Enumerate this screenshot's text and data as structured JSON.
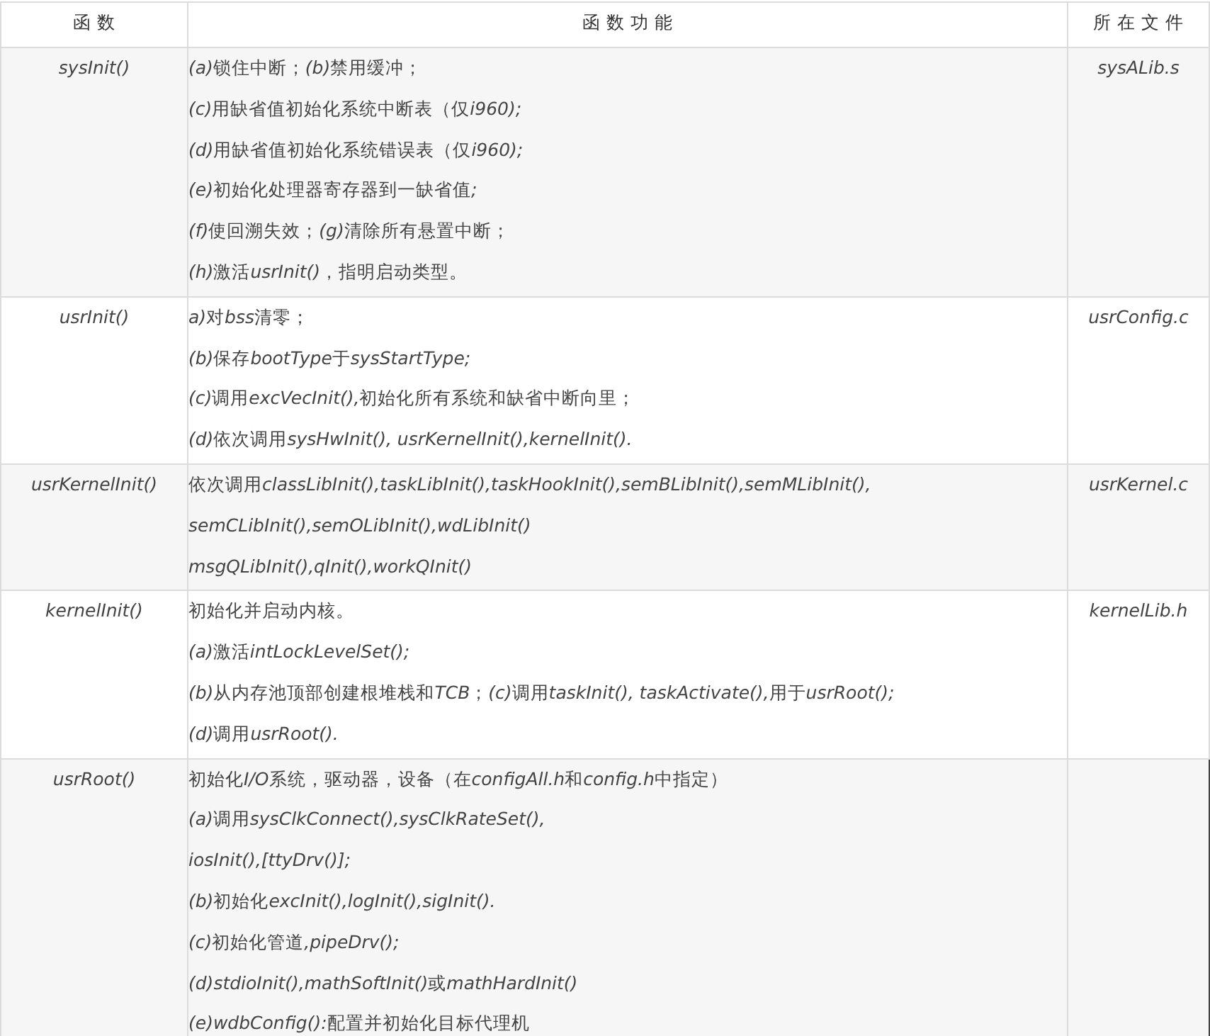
{
  "table": {
    "columns": [
      "函 数",
      "函 数 功 能",
      "所 在 文 件"
    ],
    "rows": [
      {
        "function": "sysInit()",
        "file": "sysALib.s",
        "lines": [
          [
            {
              "text": "(a)",
              "italic": true
            },
            {
              "text": "锁住中断；",
              "italic": false
            },
            {
              "text": "(b)",
              "italic": true
            },
            {
              "text": "禁用缓冲；",
              "italic": false
            }
          ],
          [
            {
              "text": "(c)",
              "italic": true
            },
            {
              "text": "用缺省值初始化系统中断表（仅",
              "italic": false
            },
            {
              "text": "i960);",
              "italic": true
            }
          ],
          [
            {
              "text": "(d)",
              "italic": true
            },
            {
              "text": "用缺省值初始化系统错误表（仅",
              "italic": false
            },
            {
              "text": "i960);",
              "italic": true
            }
          ],
          [
            {
              "text": "(e)",
              "italic": true
            },
            {
              "text": "初始化处理器寄存器到一缺省值",
              "italic": false
            },
            {
              "text": ";",
              "italic": true
            }
          ],
          [
            {
              "text": "(f)",
              "italic": true
            },
            {
              "text": "使回溯失效；",
              "italic": false
            },
            {
              "text": "(g)",
              "italic": true
            },
            {
              "text": "清除所有悬置中断；",
              "italic": false
            }
          ],
          [
            {
              "text": "(h)",
              "italic": true
            },
            {
              "text": "激活",
              "italic": false
            },
            {
              "text": "usrInit()",
              "italic": true
            },
            {
              "text": "，指明启动类型。",
              "italic": false
            }
          ]
        ]
      },
      {
        "function": "usrInit()",
        "file": "usrConfig.c",
        "lines": [
          [
            {
              "text": "a)",
              "italic": true
            },
            {
              "text": "对",
              "italic": false
            },
            {
              "text": "bss",
              "italic": true
            },
            {
              "text": "清零；",
              "italic": false
            }
          ],
          [
            {
              "text": "(b)",
              "italic": true
            },
            {
              "text": "保存",
              "italic": false
            },
            {
              "text": "bootType",
              "italic": true
            },
            {
              "text": "于",
              "italic": false
            },
            {
              "text": "sysStartType;",
              "italic": true
            }
          ],
          [
            {
              "text": "(c)",
              "italic": true
            },
            {
              "text": "调用",
              "italic": false
            },
            {
              "text": "excVecInit(),",
              "italic": true
            },
            {
              "text": "初始化所有系统和缺省中断向里；",
              "italic": false
            }
          ],
          [
            {
              "text": "(d)",
              "italic": true
            },
            {
              "text": "依次调用",
              "italic": false
            },
            {
              "text": "sysHwInit(),  usrKernelInit(),kernelInit().",
              "italic": true
            }
          ]
        ]
      },
      {
        "function": "usrKernelInit()",
        "file": "usrKernel.c",
        "lines": [
          [
            {
              "text": "依次调用",
              "italic": false
            },
            {
              "text": "classLibInit(),taskLibInit(),taskHookInit(),semBLibInit(),semMLibInit(),",
              "italic": true
            }
          ],
          [
            {
              "text": "semCLibInit(),semOLibInit(),wdLibInit()",
              "italic": true
            }
          ],
          [
            {
              "text": "msgQLibInit(),qInit(),workQInit()",
              "italic": true
            }
          ]
        ]
      },
      {
        "function": "kernelInit()",
        "file": "kernelLib.h",
        "lines": [
          [
            {
              "text": "初始化并启动内核。",
              "italic": false
            }
          ],
          [
            {
              "text": "(a)",
              "italic": true
            },
            {
              "text": "激活",
              "italic": false
            },
            {
              "text": "intLockLevelSet();",
              "italic": true
            }
          ],
          [
            {
              "text": "(b)",
              "italic": true
            },
            {
              "text": "从内存池顶部创建根堆栈和",
              "italic": false
            },
            {
              "text": "TCB",
              "italic": true
            },
            {
              "text": "；",
              "italic": false
            },
            {
              "text": "(c)",
              "italic": true
            },
            {
              "text": "调用",
              "italic": false
            },
            {
              "text": "taskInit(), taskActivate(),",
              "italic": true
            },
            {
              "text": "用于",
              "italic": false
            },
            {
              "text": "usrRoot();",
              "italic": true
            }
          ],
          [
            {
              "text": "(d)",
              "italic": true
            },
            {
              "text": "调用",
              "italic": false
            },
            {
              "text": "usrRoot().",
              "italic": true
            }
          ]
        ]
      },
      {
        "function": "usrRoot()",
        "lines": [
          [
            {
              "text": "初始化",
              "italic": false
            },
            {
              "text": "I/O",
              "italic": true
            },
            {
              "text": "系统，驱动器，设备（在",
              "italic": false
            },
            {
              "text": "configAll.h",
              "italic": true
            },
            {
              "text": "和",
              "italic": false
            },
            {
              "text": "config.h",
              "italic": true
            },
            {
              "text": "中指定）",
              "italic": false
            }
          ],
          [
            {
              "text": "(a)",
              "italic": true
            },
            {
              "text": "调用",
              "italic": false
            },
            {
              "text": "sysClkConnect(),sysClkRateSet(),",
              "italic": true
            }
          ],
          [
            {
              "text": "iosInit(),[ttyDrv()];",
              "italic": true
            }
          ],
          [
            {
              "text": "(b)",
              "italic": true
            },
            {
              "text": "初始化",
              "italic": false
            },
            {
              "text": "excInit(),logInit(),sigInit().",
              "italic": true
            }
          ],
          [
            {
              "text": "(c)",
              "italic": true
            },
            {
              "text": "初始化管道",
              "italic": false
            },
            {
              "text": ",pipeDrv();",
              "italic": true
            }
          ],
          [
            {
              "text": "(d)stdioInit(),mathSoftInit()",
              "italic": true
            },
            {
              "text": "或",
              "italic": false
            },
            {
              "text": "mathHardInit()",
              "italic": true
            }
          ],
          [
            {
              "text": "(e)wdbConfig():",
              "italic": true
            },
            {
              "text": "配置并初始化目标代理机",
              "italic": false
            }
          ]
        ]
      }
    ]
  }
}
